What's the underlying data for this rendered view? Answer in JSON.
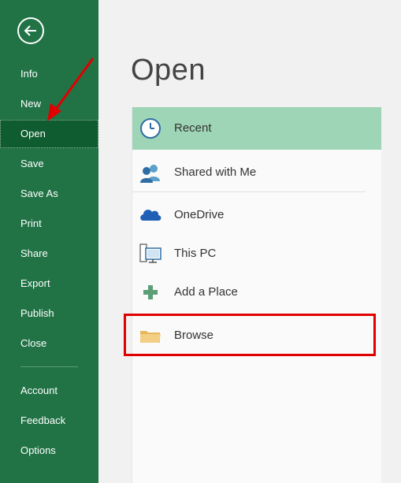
{
  "sidebar": {
    "back_icon": "back-arrow-icon",
    "items": [
      {
        "label": "Info"
      },
      {
        "label": "New"
      },
      {
        "label": "Open",
        "active": true
      },
      {
        "label": "Save"
      },
      {
        "label": "Save As"
      },
      {
        "label": "Print"
      },
      {
        "label": "Share"
      },
      {
        "label": "Export"
      },
      {
        "label": "Publish"
      },
      {
        "label": "Close"
      }
    ],
    "footer_items": [
      {
        "label": "Account"
      },
      {
        "label": "Feedback"
      },
      {
        "label": "Options"
      }
    ]
  },
  "main": {
    "title": "Open",
    "locations": [
      {
        "label": "Recent",
        "icon": "clock-icon",
        "selected": true
      },
      {
        "label": "Shared with Me",
        "icon": "people-icon"
      },
      {
        "label": "OneDrive",
        "icon": "cloud-icon"
      },
      {
        "label": "This PC",
        "icon": "computer-icon"
      },
      {
        "label": "Add a Place",
        "icon": "plus-icon"
      },
      {
        "label": "Browse",
        "icon": "folder-icon"
      }
    ]
  },
  "colors": {
    "sidebar_bg": "#217346",
    "sidebar_active": "#0e5c2f",
    "selected_bg": "#9fd5b7",
    "annotation": "#e00000"
  }
}
